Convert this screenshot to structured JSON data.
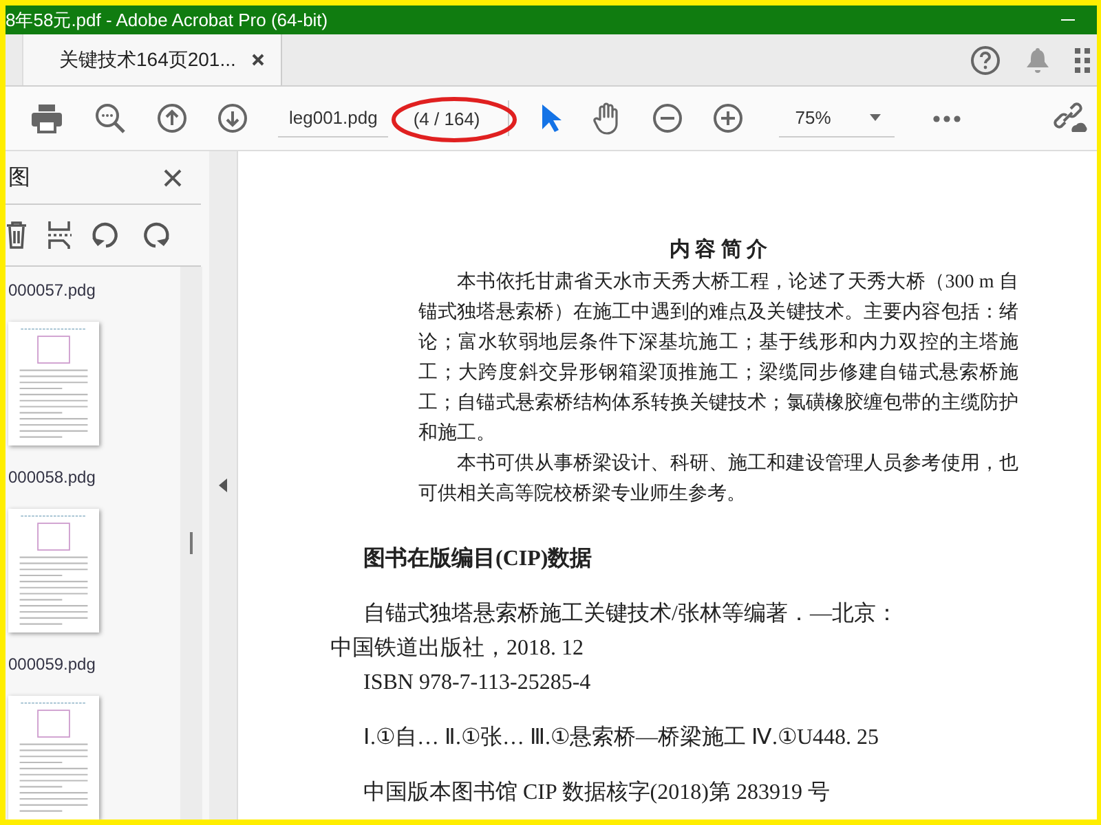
{
  "window": {
    "title": "8年58元.pdf - Adobe Acrobat Pro (64-bit)"
  },
  "tabs": [
    {
      "label": "关键技术164页201...",
      "selected": true
    }
  ],
  "toolbar": {
    "file_name": "leg001.pdg",
    "page_count": "(4 / 164)",
    "page_count_circled": true,
    "zoom": "75%",
    "tools": [
      {
        "kind": "pointer",
        "selected": true
      },
      {
        "kind": "hand",
        "selected": false
      }
    ]
  },
  "sidebar": {
    "title": "图",
    "thumbnails": [
      {
        "label": "000057.pdg"
      },
      {
        "label": "000058.pdg"
      },
      {
        "label": "000059.pdg"
      }
    ]
  },
  "document": {
    "heading": "内 容 简 介",
    "paragraphs": [
      "本书依托甘肃省天水市天秀大桥工程，论述了天秀大桥（300 m 自锚式独塔悬索桥）在施工中遇到的难点及关键技术。主要内容包括：绪论；富水软弱地层条件下深基坑施工；基于线形和内力双控的主塔施工；大跨度斜交异形钢箱梁顶推施工；梁缆同步修建自锚式悬索桥施工；自锚式悬索桥结构体系转换关键技术；氯磺橡胶缠包带的主缆防护和施工。",
      "本书可供从事桥梁设计、科研、施工和建设管理人员参考使用，也可供相关高等院校桥梁专业师生参考。"
    ],
    "cip_heading": "图书在版编目(CIP)数据",
    "cip_lines": [
      {
        "kind": "indent",
        "text": "自锚式独塔悬索桥施工关键技术/张林等编著．—北京："
      },
      {
        "kind": "outdent",
        "text": "中国铁道出版社，2018. 12"
      },
      {
        "kind": "indent",
        "text": "ISBN 978-7-113-25285-4"
      },
      {
        "kind": "gap",
        "text": "Ⅰ.①自… Ⅱ.①张… Ⅲ.①悬索桥—桥梁施工 Ⅳ.①U448. 25"
      },
      {
        "kind": "gap",
        "text": "中国版本图书馆 CIP 数据核字(2018)第 283919 号"
      }
    ]
  }
}
